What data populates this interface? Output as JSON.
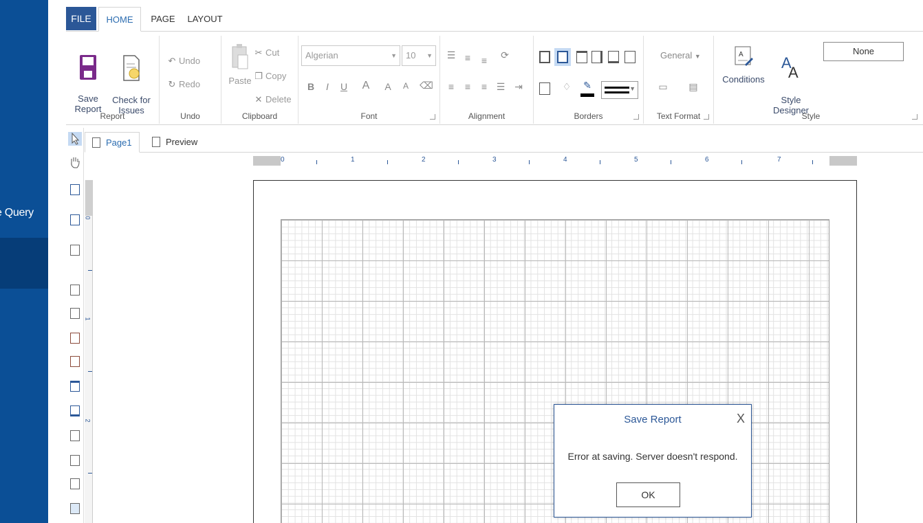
{
  "leftnav": {
    "query_label": "e Query"
  },
  "tabs": {
    "file": "FILE",
    "home": "HOME",
    "page": "PAGE",
    "layout": "LAYOUT"
  },
  "ribbon": {
    "report": {
      "label": "Report",
      "save": "Save\nReport",
      "check": "Check for\nIssues"
    },
    "undo": {
      "label": "Undo",
      "undo": "Undo",
      "redo": "Redo"
    },
    "clipboard": {
      "label": "Clipboard",
      "paste": "Paste",
      "cut": "Cut",
      "copy": "Copy",
      "delete": "Delete"
    },
    "font": {
      "label": "Font",
      "family": "Algerian",
      "size": "10",
      "bold": "B",
      "italic": "I",
      "underline": "U",
      "color": "A",
      "grow": "A",
      "shrink": "A"
    },
    "alignment": {
      "label": "Alignment"
    },
    "borders": {
      "label": "Borders"
    },
    "textformat": {
      "label": "Text Format",
      "format": "General"
    },
    "style": {
      "label": "Style",
      "conditions": "Conditions",
      "designer": "Style\nDesigner",
      "style_value": "None"
    }
  },
  "doctabs": {
    "page1": "Page1",
    "preview": "Preview"
  },
  "ruler": {
    "h": [
      "0",
      "1",
      "2",
      "3",
      "4",
      "5",
      "6",
      "7"
    ],
    "v": [
      "0",
      "1",
      "2"
    ]
  },
  "modal": {
    "title": "Save Report",
    "close": "X",
    "message": "Error at saving. Server doesn't respond.",
    "ok": "OK"
  },
  "colors": {
    "nav_blue": "#0b4f96",
    "accent": "#2b5797",
    "ok_border": "#555555"
  }
}
